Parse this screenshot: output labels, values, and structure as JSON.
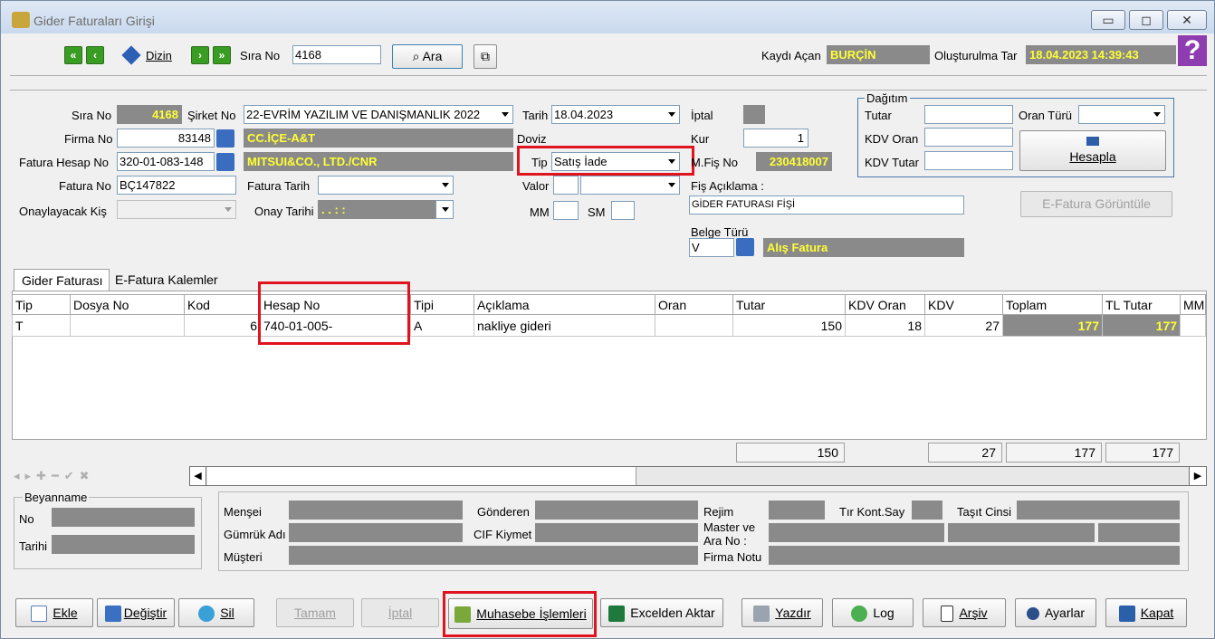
{
  "window": {
    "title": "Gider Faturaları Girişi"
  },
  "toolbar": {
    "dizin": "Dizin",
    "sira_no_label": "Sıra No",
    "sira_no_value": "4168",
    "ara": "Ara",
    "kaydi_acan_label": "Kaydı Açan",
    "kaydi_acan_value": "BURÇİN",
    "olusturma_label": "Oluşturulma Tar",
    "olusturma_value": "18.04.2023 14:39:43",
    "help": "?"
  },
  "form": {
    "sira_no_label": "Sıra No",
    "sira_no_value": "4168",
    "sirket_no_label": "Şirket No",
    "sirket_no_value": "22-EVRİM YAZILIM  VE DANIŞMANLIK 2022",
    "tarih_label": "Tarih",
    "tarih_value": "18.04.2023",
    "iptal_label": "İptal",
    "firma_no_label": "Firma No",
    "firma_no_value": "83148",
    "firma_name": "CC.İÇE-A&T",
    "doviz_label": "Doviz",
    "kur_label": "Kur",
    "kur_value": "1",
    "fatura_hesap_label": "Fatura Hesap No",
    "fatura_hesap_value": "320-01-083-148",
    "fatura_hesap_name": "MITSUI&CO., LTD./CNR",
    "tip_label": "Tip",
    "tip_value": "Satış İade",
    "mfis_label": "M.Fiş No",
    "mfis_value": "230418007",
    "fatura_no_label": "Fatura No",
    "fatura_no_value": "BÇ147822",
    "fatura_tarih_label": "Fatura Tarih",
    "valor_label": "Valor",
    "fis_aciklama_label": "Fiş Açıklama :",
    "fis_aciklama_value": "GİDER FATURASI FİŞİ",
    "onaylayacak_label": "Onaylayacak Kiş",
    "onay_tarihi_label": "Onay Tarihi",
    "onay_tarihi_value": ". .    : :",
    "mm_label": "MM",
    "sm_label": "SM",
    "belge_turu_label": "Belge Türü",
    "belge_turu_value": "V",
    "belge_turu_name": "Alış Fatura"
  },
  "dagitim": {
    "legend": "Dağıtım",
    "tutar": "Tutar",
    "oran_turu": "Oran Türü",
    "kdv_oran": "KDV Oran",
    "kdv_tutar": "KDV Tutar",
    "hesapla": "Hesapla",
    "efatura": "E-Fatura Görüntüle"
  },
  "tabs": [
    "Gider Faturası",
    "E-Fatura Kalemler"
  ],
  "grid": {
    "headers": [
      "Tip",
      "Dosya No",
      "Kod",
      "Hesap No",
      "Tipi",
      "Açıklama",
      "Oran",
      "Tutar",
      "KDV Oran",
      "KDV",
      "Toplam",
      "TL Tutar",
      "MM"
    ],
    "row": {
      "tip": "T",
      "dosya": "",
      "kod": "6",
      "hesap": "740-01-005-",
      "tipi": "A",
      "aciklama": "nakliye gideri",
      "oran": "",
      "tutar": "150",
      "kdv_oran": "18",
      "kdv": "27",
      "toplam": "177",
      "tl_tutar": "177"
    },
    "totals": {
      "tutar": "150",
      "kdv": "27",
      "toplam": "177",
      "tl_tutar": "177"
    }
  },
  "beyanname": {
    "legend": "Beyanname",
    "no": "No",
    "tarihi": "Tarihi"
  },
  "details": {
    "mensei": "Menşei",
    "gonderen": "Gönderen",
    "rejim": "Rejim",
    "tir": "Tır Kont.Say",
    "tasit": "Taşıt Cinsi",
    "gumruk": "Gümrük Adı",
    "cif": "CIF Kiymet",
    "master1": "Master ve",
    "master2": "Ara No :",
    "musteri": "Müşteri",
    "firma_notu": "Firma Notu"
  },
  "buttons": {
    "ekle": "Ekle",
    "degistir": "Değiştir",
    "sil": "Sil",
    "tamam": "Tamam",
    "iptal": "İptal",
    "muhasebe": "Muhasebe İşlemleri",
    "excel": "Excelden Aktar",
    "yazdir": "Yazdır",
    "log": "Log",
    "arsiv": "Arşiv",
    "ayarlar": "Ayarlar",
    "kapat": "Kapat"
  }
}
